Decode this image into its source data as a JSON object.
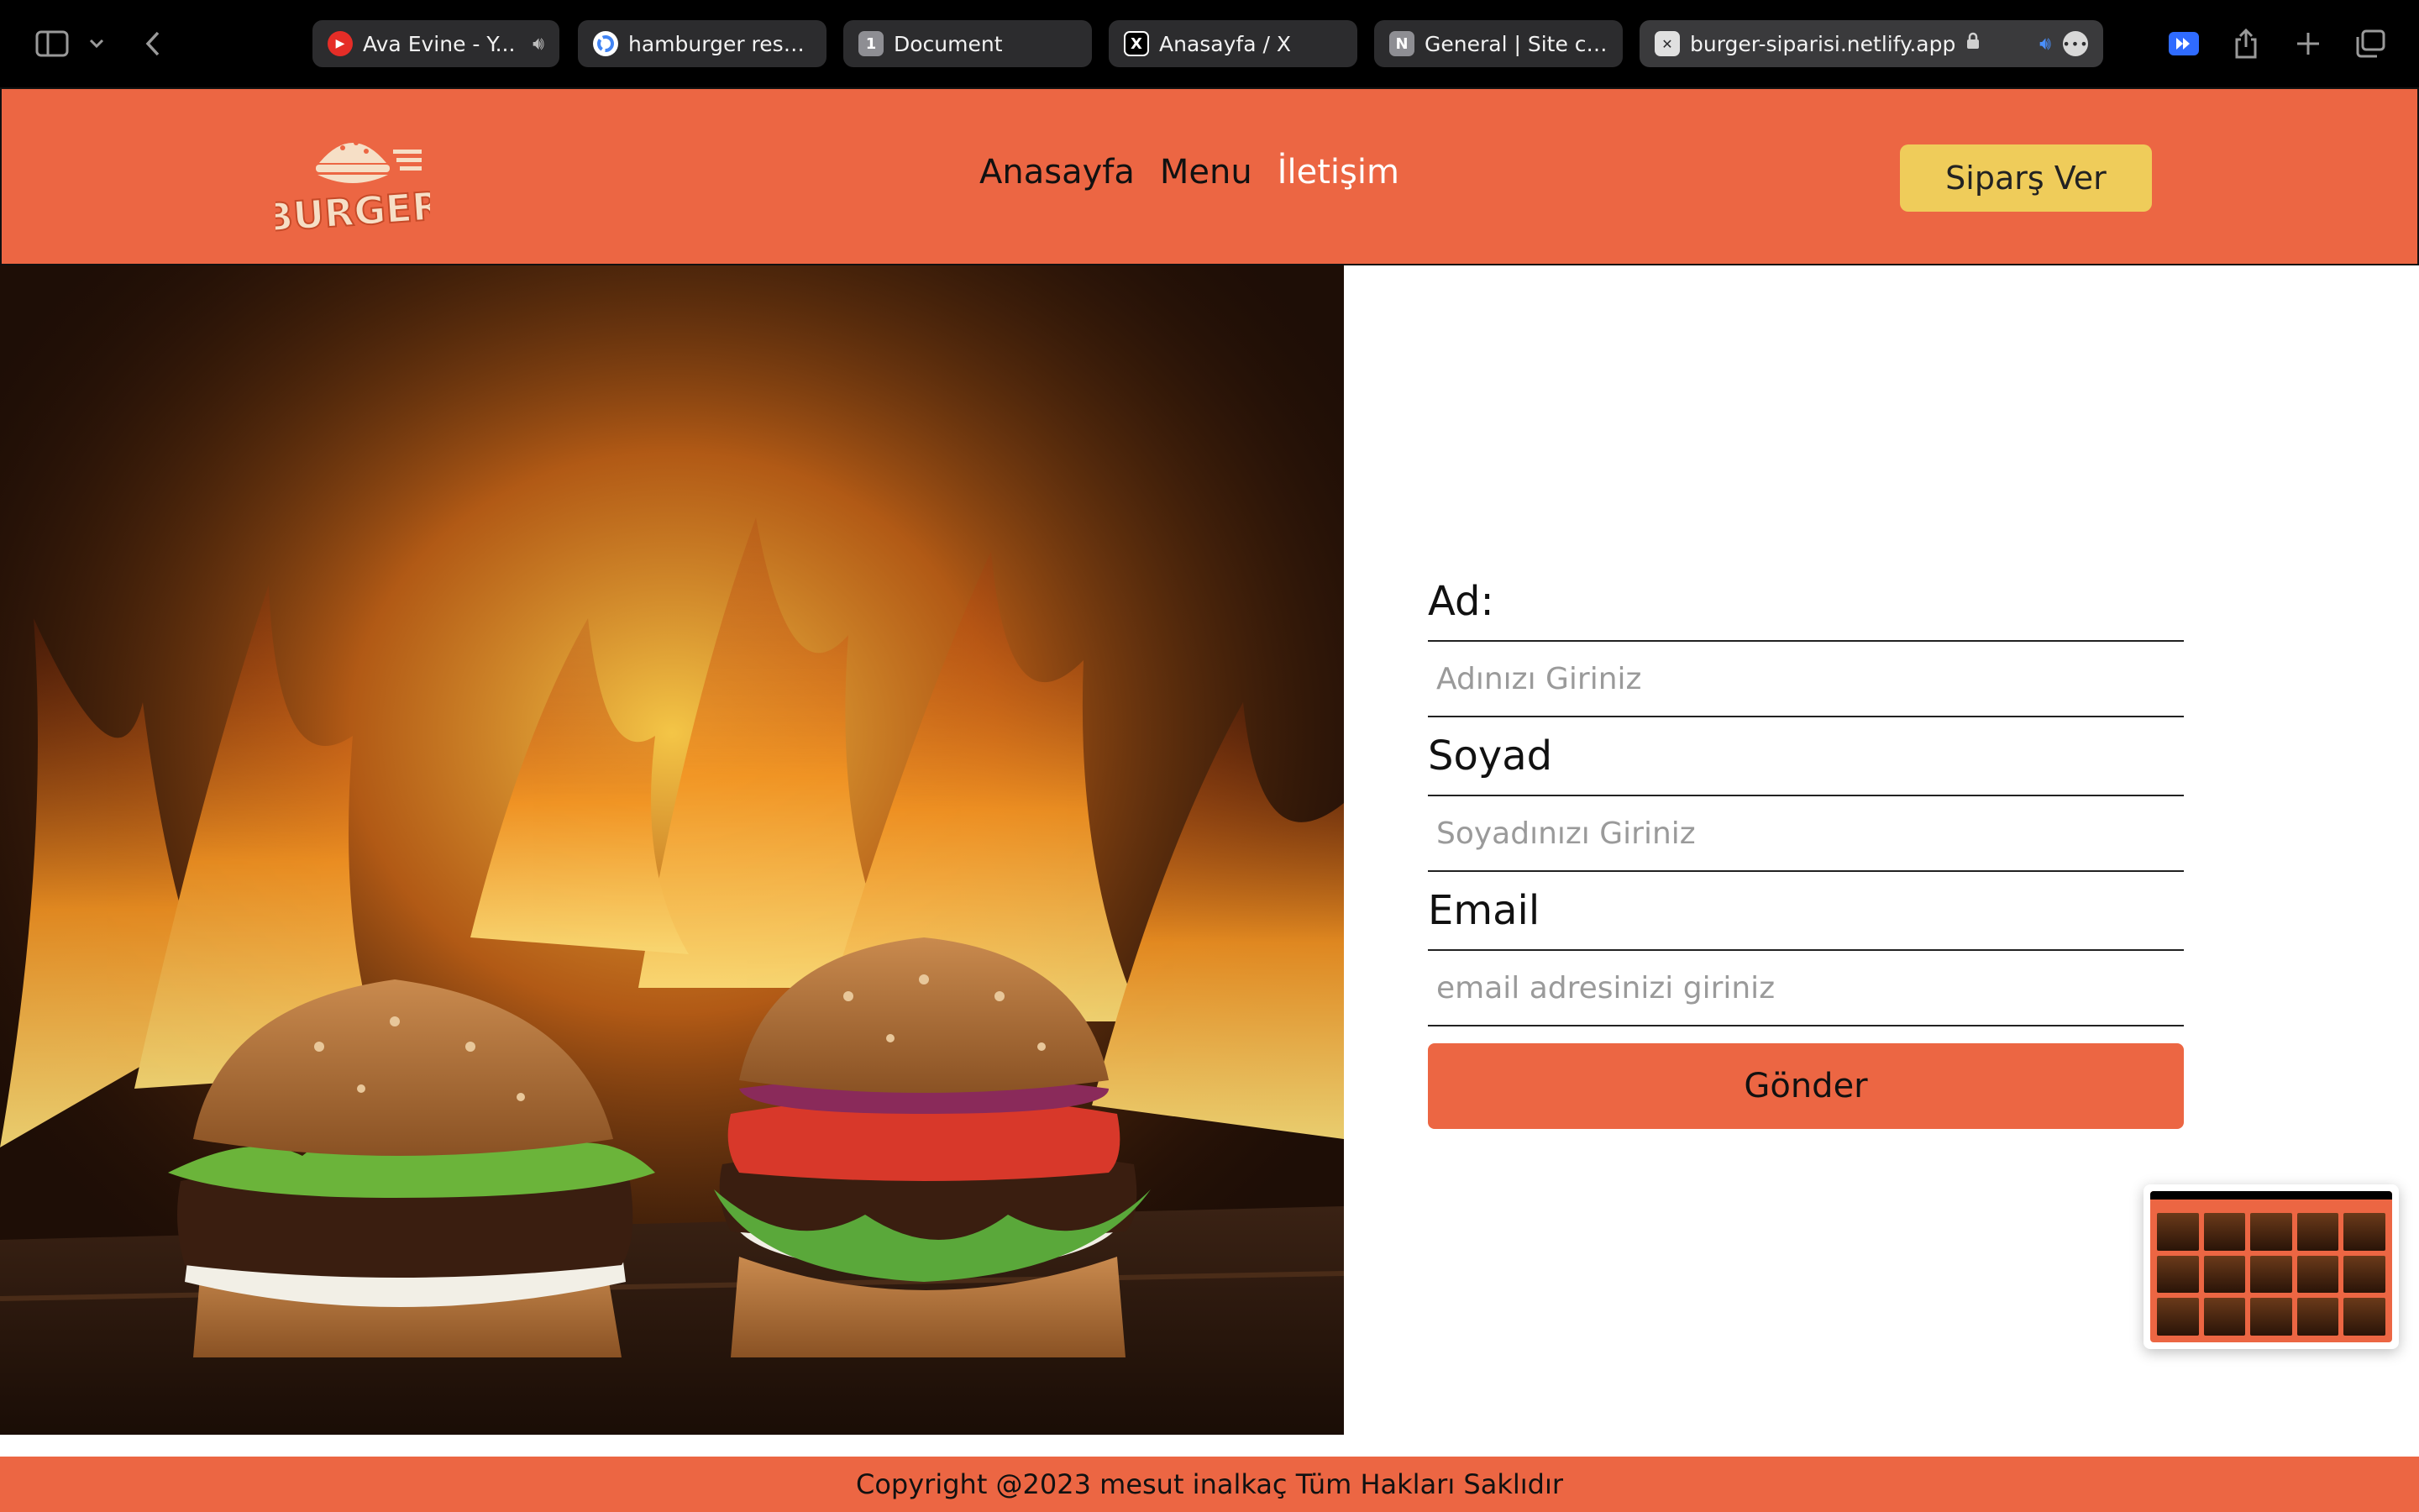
{
  "browser": {
    "tabs": [
      {
        "title": "Ava Evine - Y...",
        "favicon": "youtube-music-icon",
        "audio": true
      },
      {
        "title": "hamburger resmi...",
        "favicon": "google-icon"
      },
      {
        "title": "Document",
        "favicon": "number-1-icon",
        "favicon_text": "1"
      },
      {
        "title": "Anasayfa / X",
        "favicon": "x-icon",
        "favicon_text": "X"
      },
      {
        "title": "General | Site con...",
        "favicon": "netlify-n-icon",
        "favicon_text": "N"
      },
      {
        "title": "burger-siparisi.netlify.app",
        "favicon": "close-x-icon",
        "favicon_text": "✕",
        "active": true,
        "audio": true
      }
    ]
  },
  "header": {
    "logo_text": "BURGER",
    "nav": {
      "home": "Anasayfa",
      "menu": "Menu",
      "contact": "İletişim"
    },
    "order_button": "Siparş Ver"
  },
  "form": {
    "name_label": "Ad:",
    "name_placeholder": "Adınızı Giriniz",
    "surname_label": "Soyad",
    "surname_placeholder": "Soyadınızı Giriniz",
    "email_label": "Email",
    "email_placeholder": "email adresinizi giriniz",
    "submit_label": "Gönder"
  },
  "footer": {
    "copyright": "Copyright @2023 mesut inalkaç Tüm Hakları Saklıdır"
  },
  "colors": {
    "brand": "#ec6643",
    "accent": "#efcc5a",
    "nav_active": "#ffffff"
  }
}
